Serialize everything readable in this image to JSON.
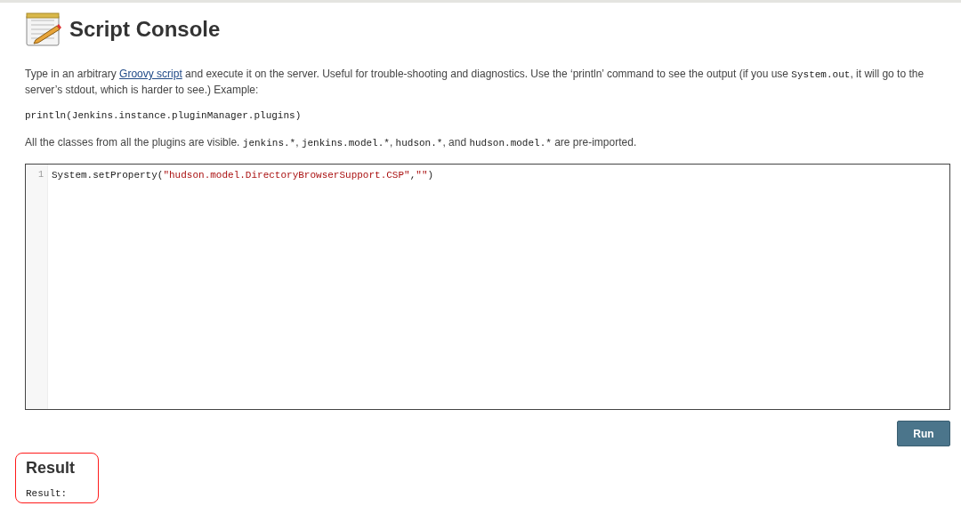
{
  "page": {
    "title": "Script Console"
  },
  "intro": [
    {
      "kind": "text",
      "text": "Type in an arbitrary "
    },
    {
      "kind": "link",
      "text": "Groovy script"
    },
    {
      "kind": "text",
      "text": " and execute it on the server. Useful for trouble-shooting and diagnostics. Use the ‘println’ command to see the output (if you use "
    },
    {
      "kind": "code",
      "text": "System.out"
    },
    {
      "kind": "text",
      "text": ", it will go to the server’s stdout, which is harder to see.) Example:"
    }
  ],
  "example": "println(Jenkins.instance.pluginManager.plugins)",
  "imports_note": [
    {
      "kind": "text",
      "text": "All the classes from all the plugins are visible. "
    },
    {
      "kind": "code",
      "text": "jenkins.*"
    },
    {
      "kind": "text",
      "text": ", "
    },
    {
      "kind": "code",
      "text": "jenkins.model.*"
    },
    {
      "kind": "text",
      "text": ", "
    },
    {
      "kind": "code",
      "text": "hudson.*"
    },
    {
      "kind": "text",
      "text": ", and "
    },
    {
      "kind": "code",
      "text": "hudson.model.*"
    },
    {
      "kind": "text",
      "text": " are pre-imported."
    }
  ],
  "editor": {
    "lines": [
      {
        "number": "1",
        "tokens": [
          {
            "kind": "plain",
            "text": "System.setProperty("
          },
          {
            "kind": "string",
            "text": "\"hudson.model.DirectoryBrowserSupport.CSP\""
          },
          {
            "kind": "plain",
            "text": ","
          },
          {
            "kind": "string",
            "text": "\"\""
          },
          {
            "kind": "plain",
            "text": ")"
          }
        ]
      }
    ]
  },
  "run_button": "Run",
  "result": {
    "heading": "Result",
    "output": "Result:",
    "highlighted": true
  }
}
